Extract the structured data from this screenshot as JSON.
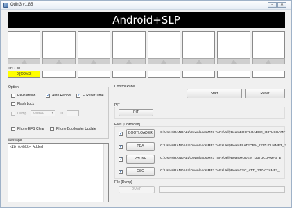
{
  "window": {
    "title": "Odin3 v1.85",
    "minimize_icon": "minimize-icon",
    "close_icon": "close-icon"
  },
  "banner": {
    "text": "Android+SLP"
  },
  "idcom": {
    "label": "ID:COM",
    "active_port": "0:[COM3]"
  },
  "option": {
    "title": "Option",
    "re_partition": {
      "label": "Re-Partition",
      "checked": false
    },
    "auto_reboot": {
      "label": "Auto Reboot",
      "checked": true
    },
    "f_reset_time": {
      "label": "F. Reset Time",
      "checked": true
    },
    "flash_lock": {
      "label": "Flash Lock",
      "checked": false
    },
    "dump": {
      "label": "Dump",
      "checked": false,
      "enabled": false
    },
    "dump_select": {
      "value": "AP RAM"
    },
    "id_label": "ID",
    "phone_efs_clear": {
      "label": "Phone EFS Clear",
      "checked": false
    },
    "phone_bootloader_update": {
      "label": "Phone Bootloader Update",
      "checked": false
    }
  },
  "message": {
    "title": "Message",
    "text": "<ID:0/003> Added!!"
  },
  "control_panel": {
    "title": "Control Panel",
    "start_label": "Start",
    "reset_label": "Reset"
  },
  "pit": {
    "title": "PIT",
    "button_label": "PIT"
  },
  "files": {
    "title": "Files [Download]",
    "rows": [
      {
        "label": "BOOTLOADER",
        "checked": true,
        "path": "C:\\Users\\RANDALL\\Downloads\\MF3 TARs\\JellyBean\\BOOTLOADER_I337UCUAMF"
      },
      {
        "label": "PDA",
        "checked": true,
        "path": "C:\\Users\\RANDALL\\Downloads\\MF3 TARs\\JellyBean\\PLATFORM_I337UCUAMF3_I3"
      },
      {
        "label": "PHONE",
        "checked": true,
        "path": "C:\\Users\\RANDALL\\Downloads\\MF3 TARs\\JellyBean\\MODEM_I337UCUAMF3_B"
      },
      {
        "label": "CSC",
        "checked": true,
        "path": "C:\\Users\\RANDALL\\Downloads\\MF3 TARs\\JellyBean\\CSC_ATT_I337ATTAMF3_"
      }
    ]
  },
  "file_dump": {
    "title": "File [Dump]",
    "button_label": "DUMP"
  }
}
